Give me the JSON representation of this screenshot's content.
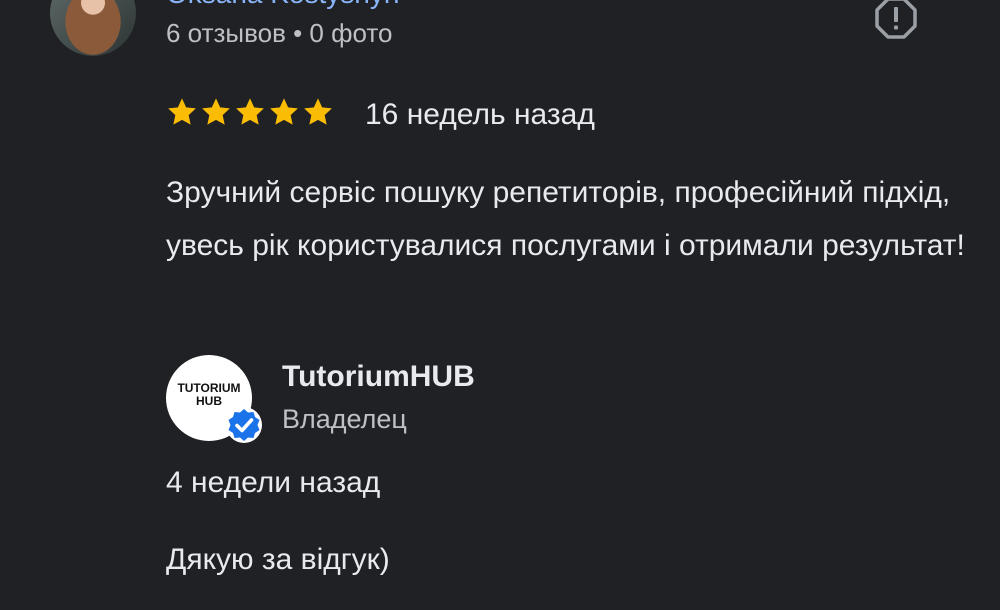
{
  "review": {
    "reviewer_name": "Oksana Kostyshyn",
    "reviewer_meta": "6 отзывов • 0 фото",
    "rating": 5,
    "rating_max": 5,
    "time": "16 недель назад",
    "text": "Зручний сервіс пошуку репетиторів, професійний підхід, увесь рік користувалися послугами і отримали результат!"
  },
  "reply": {
    "owner_name": "TutoriumHUB",
    "owner_role": "Владелец",
    "logo_text": "TUTORIUM HUB",
    "time": "4 недели назад",
    "text": "Дякую за відгук)"
  },
  "icons": {
    "report": "report-icon",
    "verified": "verified-badge-icon",
    "star": "star-icon"
  },
  "colors": {
    "background": "#202124",
    "star": "#fbbc04",
    "link": "#8ab4f8",
    "verified": "#1a73e8"
  }
}
